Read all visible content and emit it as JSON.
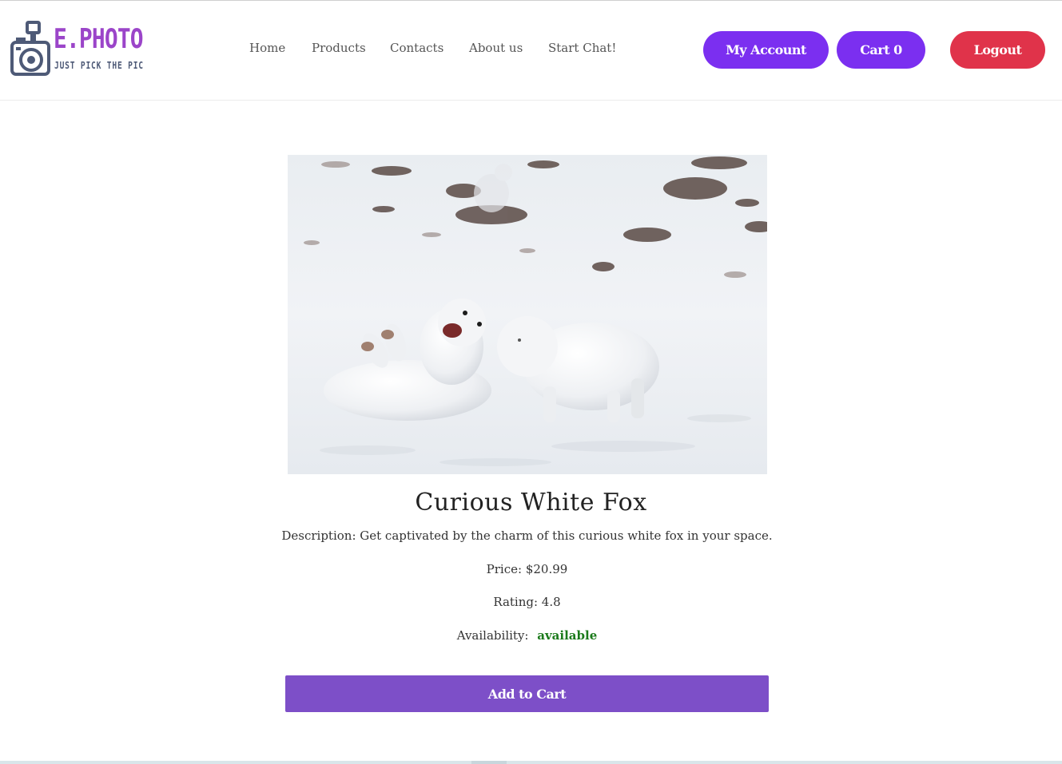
{
  "brand": {
    "name": "E.PHOTO",
    "tagline": "JUST PICK THE PIC",
    "primary_color": "#7b2ff0",
    "logo_title_color": "#9b45c9",
    "logout_color": "#e0334a"
  },
  "nav": {
    "items": [
      {
        "label": "Home"
      },
      {
        "label": "Products"
      },
      {
        "label": "Contacts"
      },
      {
        "label": "About us"
      },
      {
        "label": "Start Chat!"
      }
    ]
  },
  "header_actions": {
    "account_label": "My Account",
    "cart_label": "Cart 0",
    "logout_label": "Logout"
  },
  "product": {
    "image_alt": "Two white arctic foxes playing in the snow",
    "title": "Curious White Fox",
    "description": "Description: Get captivated by the charm of this curious white fox in your space.",
    "price_text": "Price: $20.99",
    "rating_text": "Rating: 4.8",
    "availability_label": "Availability:",
    "availability_value": "available",
    "availability_color": "#1b7a1b",
    "add_to_cart_label": "Add to Cart"
  },
  "icons": {
    "logo": "camera-icon"
  }
}
